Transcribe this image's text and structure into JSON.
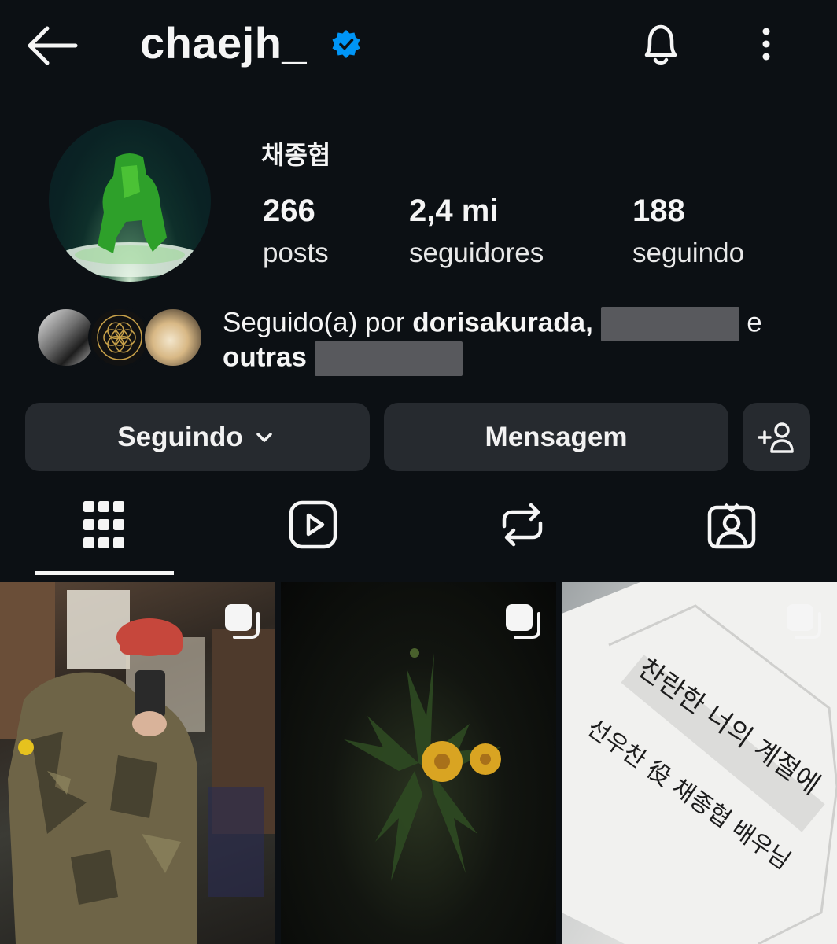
{
  "header": {
    "username": "chaejh_",
    "back_icon": "arrow-left-icon",
    "verified_icon": "verified-badge-icon",
    "notifications_icon": "bell-icon",
    "menu_icon": "more-vertical-icon"
  },
  "profile": {
    "full_name": "채종협",
    "stats": {
      "posts_count": "266",
      "posts_label": "posts",
      "followers_count": "2,4 mi",
      "followers_label": "seguidores",
      "following_count": "188",
      "following_label": "seguindo"
    }
  },
  "followed_by": {
    "prefix": "Seguido(a) por ",
    "first_user": "dorisakurada,",
    "conjunction": " e",
    "others": "outras"
  },
  "actions": {
    "following_label": "Seguindo",
    "message_label": "Mensagem",
    "add_user_icon": "add-user-icon"
  },
  "tabs": [
    {
      "name": "posts",
      "icon": "grid-icon",
      "selected": true
    },
    {
      "name": "reels",
      "icon": "reels-icon",
      "selected": false
    },
    {
      "name": "reposts",
      "icon": "repost-icon",
      "selected": false
    },
    {
      "name": "tagged",
      "icon": "tagged-icon",
      "selected": false
    }
  ],
  "posts": [
    {
      "name": "post-1",
      "multi": true
    },
    {
      "name": "post-2",
      "multi": true
    },
    {
      "name": "post-3",
      "multi": true,
      "handwriting": [
        "찬란한 너의 계절에",
        "선우찬 役 채종협 배우님"
      ]
    }
  ],
  "colors": {
    "background": "#0c1014",
    "button": "#262a2f",
    "verified": "#0095f6",
    "text": "#f5f5f5"
  }
}
